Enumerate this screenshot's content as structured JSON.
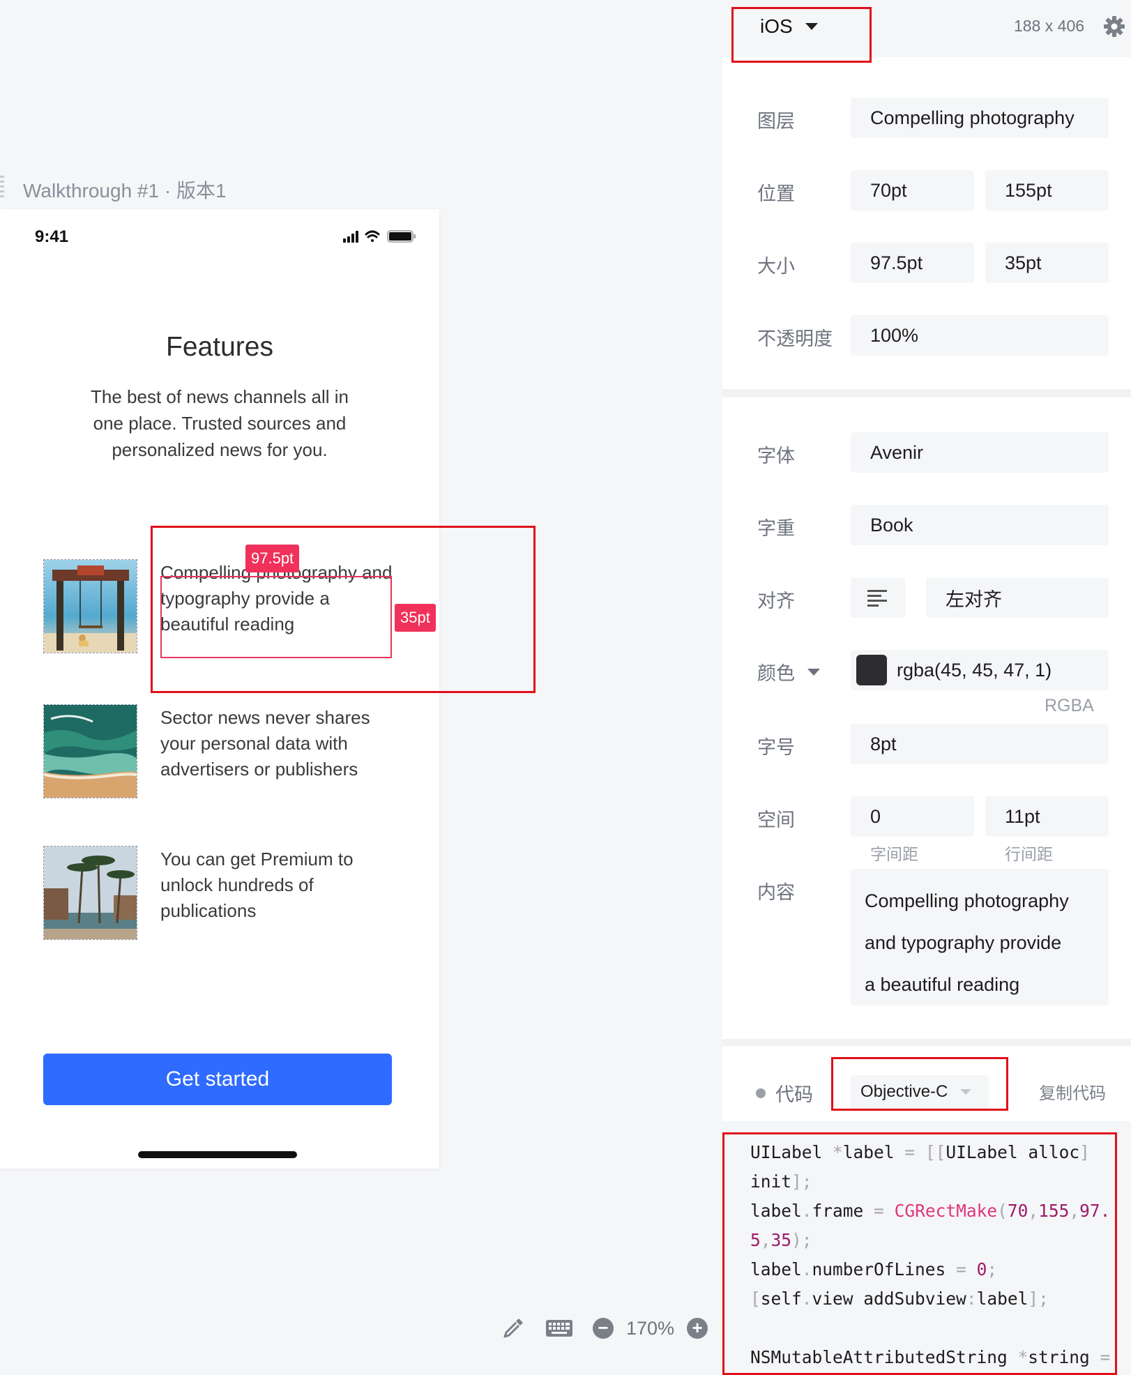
{
  "canvas": {
    "artboard_title": "Walkthrough #1 · 版本1",
    "zoom": "170%"
  },
  "phone": {
    "status_time": "9:41",
    "title": "Features",
    "description": "The best of news channels all in one place. Trusted sources and personalized news for you.",
    "items": [
      {
        "text": "Compelling photography and typography provide a beautiful reading"
      },
      {
        "text": "Sector news never shares your personal data with advertisers or publishers"
      },
      {
        "text": "You can get Premium to unlock hundreds of publications"
      }
    ],
    "button_label": "Get started"
  },
  "measure": {
    "width_tag": "97.5pt",
    "height_tag": "35pt"
  },
  "inspector": {
    "platform": "iOS",
    "dimensions": "188 x 406",
    "layer": {
      "label": "图层",
      "value": "Compelling photography"
    },
    "position": {
      "label": "位置",
      "x": "70pt",
      "y": "155pt"
    },
    "size": {
      "label": "大小",
      "w": "97.5pt",
      "h": "35pt"
    },
    "opacity": {
      "label": "不透明度",
      "value": "100%"
    },
    "font": {
      "label": "字体",
      "value": "Avenir"
    },
    "weight": {
      "label": "字重",
      "value": "Book"
    },
    "align": {
      "label": "对齐",
      "value": "左对齐"
    },
    "color": {
      "label": "颜色",
      "value": "rgba(45, 45, 47, 1)",
      "mode": "RGBA",
      "swatch": "#2d2d2f"
    },
    "font_size": {
      "label": "字号",
      "value": "8pt"
    },
    "spacing": {
      "label": "空间",
      "letter": "0",
      "line": "11pt",
      "letter_label": "字间距",
      "line_label": "行间距"
    },
    "content": {
      "label": "内容",
      "lines": [
        "Compelling photography",
        "and typography provide",
        "a beautiful reading"
      ]
    },
    "code": {
      "label": "代码",
      "language": "Objective-C",
      "copy_label": "复制代码",
      "lines": [
        "UILabel *label = [[UILabel alloc]",
        "init];",
        "label.frame = CGRectMake(70,155,97.",
        "5,35);",
        "label.numberOfLines = 0;",
        "[self.view addSubview:label];",
        "",
        "NSMutableAttributedString *string ="
      ]
    }
  },
  "colors": {
    "accent_blue": "#2f6bff",
    "highlight_red": "#e0101a",
    "measure_pink": "#f0315a",
    "text_color": "#2d2d2f"
  }
}
